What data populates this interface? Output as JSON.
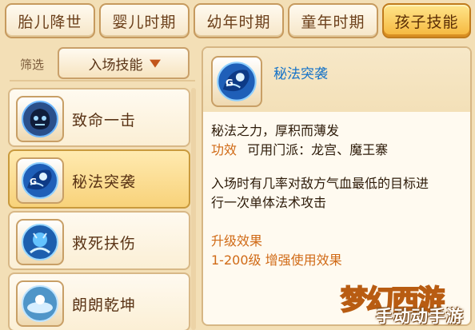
{
  "tabs": [
    {
      "label": "胎儿降世",
      "active": false
    },
    {
      "label": "婴儿时期",
      "active": false
    },
    {
      "label": "幼年时期",
      "active": false
    },
    {
      "label": "童年时期",
      "active": false
    },
    {
      "label": "孩子技能",
      "active": true
    }
  ],
  "filter": {
    "label": "筛选",
    "selected": "入场技能"
  },
  "skills": [
    {
      "name": "致命一击",
      "icon": "dark-skull-fist-icon",
      "selected": false
    },
    {
      "name": "秘法突袭",
      "icon": "blue-arcane-spirit-icon",
      "selected": true
    },
    {
      "name": "救死扶伤",
      "icon": "blue-healing-orb-icon",
      "selected": false
    },
    {
      "name": "朗朗乾坤",
      "icon": "blue-sky-orb-icon",
      "selected": false
    }
  ],
  "detail": {
    "title": "秘法突袭",
    "icon": "blue-arcane-spirit-icon",
    "flavor": "秘法之力，厚积而薄发",
    "effect_label": "功效",
    "effect_text": "可用门派：龙宫、魔王寨",
    "description_line1": "入场时有几率对敌方气血最低的目标进",
    "description_line2": "行一次单体法术攻击",
    "upgrade_label": "升级效果",
    "upgrade_text": "1-200级 增强使用效果"
  },
  "watermark": {
    "logo": "梦幻西游",
    "site": "手动动手游"
  },
  "colors": {
    "background": "#f3dfb6",
    "active_tab": "#f5b63c",
    "title_blue": "#1673c8",
    "label_orange": "#d06a16"
  }
}
